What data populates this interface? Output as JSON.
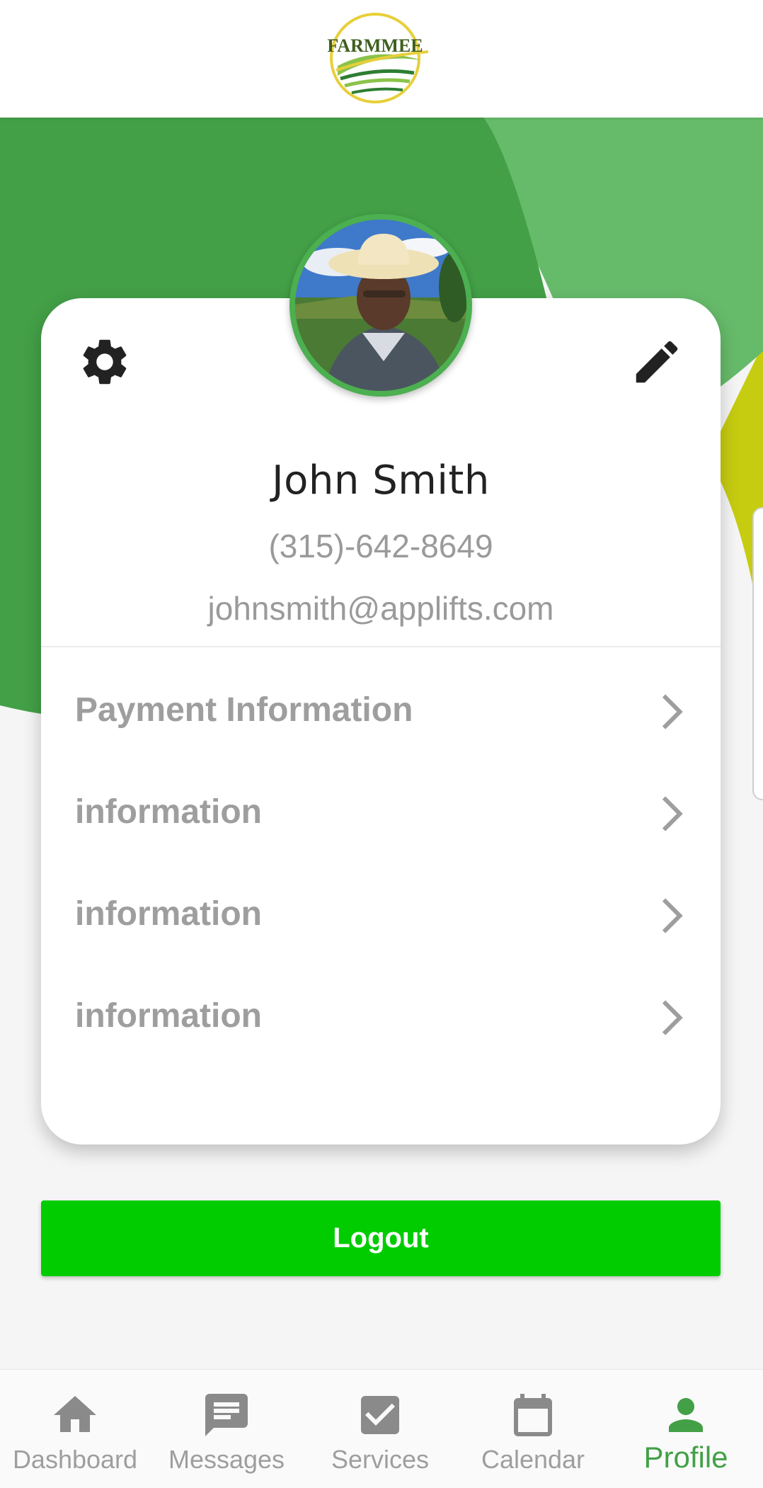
{
  "app": {
    "logo_text": "FARMMEE"
  },
  "colors": {
    "primary_green": "#4caf50",
    "dark_green": "#43a047",
    "light_green": "#66bb6a",
    "lime": "#cddc39",
    "logout_green": "#00cc00"
  },
  "profile": {
    "name": "John Smith",
    "phone": "(315)-642-8649",
    "email": "johnsmith@applifts.com",
    "settings_icon": "gear-icon",
    "edit_icon": "pencil-icon"
  },
  "menu": [
    {
      "label": "Payment Information"
    },
    {
      "label": "information"
    },
    {
      "label": "information"
    },
    {
      "label": "information"
    }
  ],
  "logout": {
    "label": "Logout"
  },
  "nav": [
    {
      "label": "Dashboard",
      "icon": "home-icon",
      "active": false
    },
    {
      "label": "Messages",
      "icon": "message-icon",
      "active": false
    },
    {
      "label": "Services",
      "icon": "checkbox-icon",
      "active": false
    },
    {
      "label": "Calendar",
      "icon": "calendar-icon",
      "active": false
    },
    {
      "label": "Profile",
      "icon": "person-icon",
      "active": true
    }
  ]
}
